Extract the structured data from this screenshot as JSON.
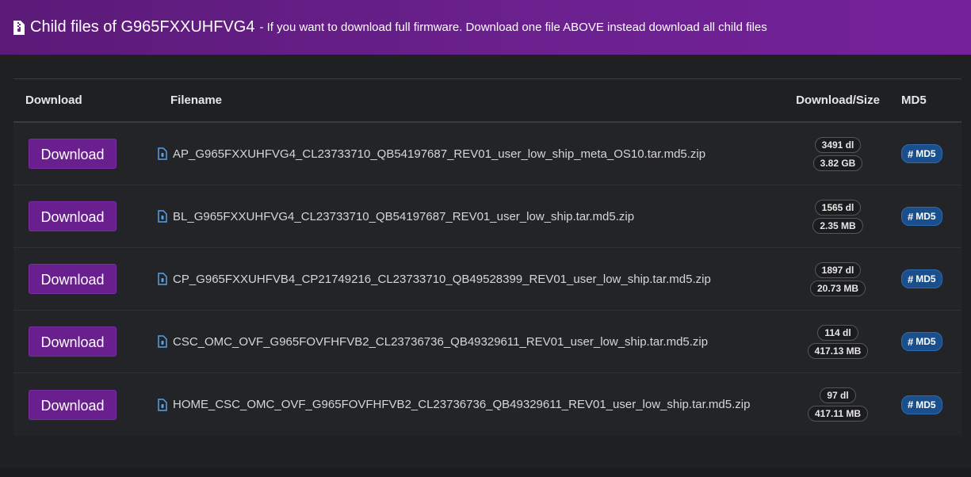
{
  "header": {
    "title": "Child files of G965FXXUHFVG4",
    "subtitle": "- If you want to download full firmware. Download one file ABOVE instead download all child files"
  },
  "table": {
    "columns": {
      "download": "Download",
      "filename": "Filename",
      "size": "Download/Size",
      "md5": "MD5"
    },
    "rows": [
      {
        "button": "Download",
        "filename": "AP_G965FXXUHFVG4_CL23733710_QB54197687_REV01_user_low_ship_meta_OS10.tar.md5.zip",
        "downloads": "3491 dl",
        "size": "3.82 GB",
        "md5": "MD5"
      },
      {
        "button": "Download",
        "filename": "BL_G965FXXUHFVG4_CL23733710_QB54197687_REV01_user_low_ship.tar.md5.zip",
        "downloads": "1565 dl",
        "size": "2.35 MB",
        "md5": "MD5"
      },
      {
        "button": "Download",
        "filename": "CP_G965FXXUHFVB4_CP21749216_CL23733710_QB49528399_REV01_user_low_ship.tar.md5.zip",
        "downloads": "1897 dl",
        "size": "20.73 MB",
        "md5": "MD5"
      },
      {
        "button": "Download",
        "filename": "CSC_OMC_OVF_G965FOVFHFVB2_CL23736736_QB49329611_REV01_user_low_ship.tar.md5.zip",
        "downloads": "114 dl",
        "size": "417.13 MB",
        "md5": "MD5"
      },
      {
        "button": "Download",
        "filename": "HOME_CSC_OMC_OVF_G965FOVFHFVB2_CL23736736_QB49329611_REV01_user_low_ship.tar.md5.zip",
        "downloads": "97 dl",
        "size": "417.11 MB",
        "md5": "MD5"
      }
    ]
  },
  "colors": {
    "header_bg": "#6c2190",
    "button_bg": "#6a1f8f",
    "md5_badge_bg": "#1a4f8b",
    "file_icon": "#5aa0e6"
  },
  "icons": {
    "header": "zip-file-icon",
    "row": "file-archive-icon",
    "md5": "hash-icon"
  }
}
